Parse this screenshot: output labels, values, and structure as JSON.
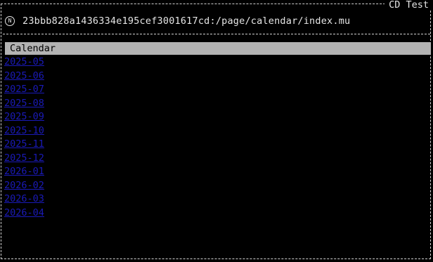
{
  "window": {
    "title": "CD Test"
  },
  "address_bar": {
    "node_icon": "circled-n-icon",
    "node_glyph": "N",
    "url": "23bbb828a1436334e195cef3001617cd:/page/calendar/index.mu"
  },
  "page": {
    "heading": "Calendar",
    "months": [
      "2025-05",
      "2025-06",
      "2025-07",
      "2025-08",
      "2025-09",
      "2025-10",
      "2025-11",
      "2025-12",
      "2026-01",
      "2026-02",
      "2026-03",
      "2026-04"
    ]
  },
  "colors": {
    "background": "#000000",
    "text": "#e6e6e6",
    "header_bg": "#b3b3b3",
    "link": "#1a1ab8"
  }
}
